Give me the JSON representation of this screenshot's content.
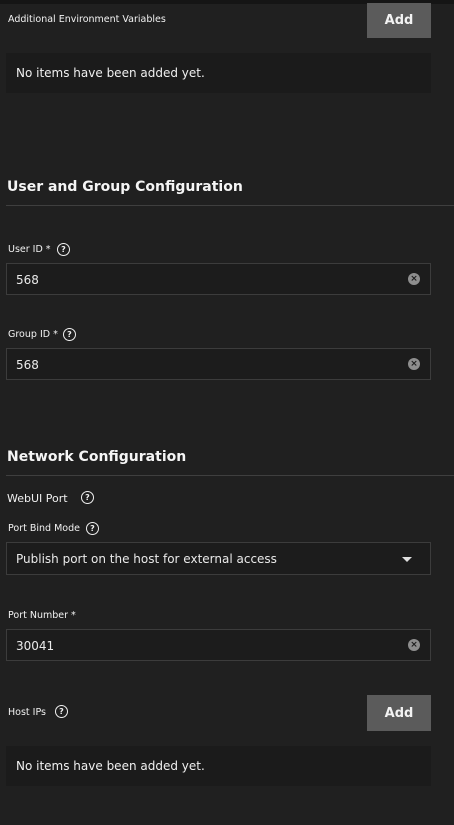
{
  "env": {
    "label": "Additional Environment Variables",
    "add_label": "Add",
    "empty_text": "No items have been added yet."
  },
  "user_group": {
    "title": "User and Group Configuration",
    "user_id_label": "User ID *",
    "user_id_value": "568",
    "group_id_label": "Group ID *",
    "group_id_value": "568"
  },
  "network": {
    "title": "Network Configuration",
    "webui_label": "WebUI Port",
    "bind_mode_label": "Port Bind Mode",
    "bind_mode_value": "Publish port on the host for external access",
    "port_number_label": "Port Number *",
    "port_number_value": "30041",
    "host_ips_label": "Host IPs",
    "add_label": "Add",
    "empty_text": "No items have been added yet."
  },
  "icons": {
    "help": "question-circle-icon",
    "clear": "clear-x-icon",
    "dropdown": "caret-down-icon"
  }
}
